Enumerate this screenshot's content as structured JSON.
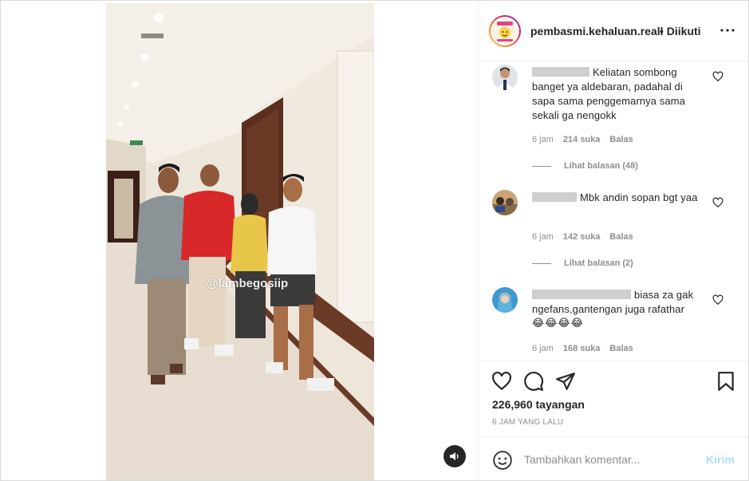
{
  "header": {
    "username": "pembasmi.kehaluan.reall",
    "follow_status": "• Diikuti",
    "more_icon": "more-horizontal-icon"
  },
  "media": {
    "watermark": "@lambegosiip",
    "mute_icon": "speaker-icon"
  },
  "comments": [
    {
      "text": "Keliatan sombong banget ya aldebaran, padahal di sapa sama penggemarnya sama sekali ga nengokk",
      "time": "6 jam",
      "likes": "214 suka",
      "reply_label": "Balas",
      "view_replies": "Lihat balasan (48)"
    },
    {
      "text": "Mbk andin sopan bgt yaa",
      "time": "6 jam",
      "likes": "142 suka",
      "reply_label": "Balas",
      "view_replies": "Lihat balasan (2)"
    },
    {
      "text": "biasa za gak ngefans,gantengan juga rafathar",
      "emoji": "😂😂😂😂",
      "time": "6 jam",
      "likes": "168 suka",
      "reply_label": "Balas"
    }
  ],
  "actions": {
    "views": "226,960 tayangan",
    "time_ago": "6 JAM YANG LALU"
  },
  "comment_box": {
    "placeholder": "Tambahkan komentar...",
    "post_label": "Kirim"
  },
  "colors": {
    "text": "#262626",
    "muted": "#8e8e8e",
    "post_disabled": "#b2dffc",
    "border": "#dbdbdb"
  }
}
